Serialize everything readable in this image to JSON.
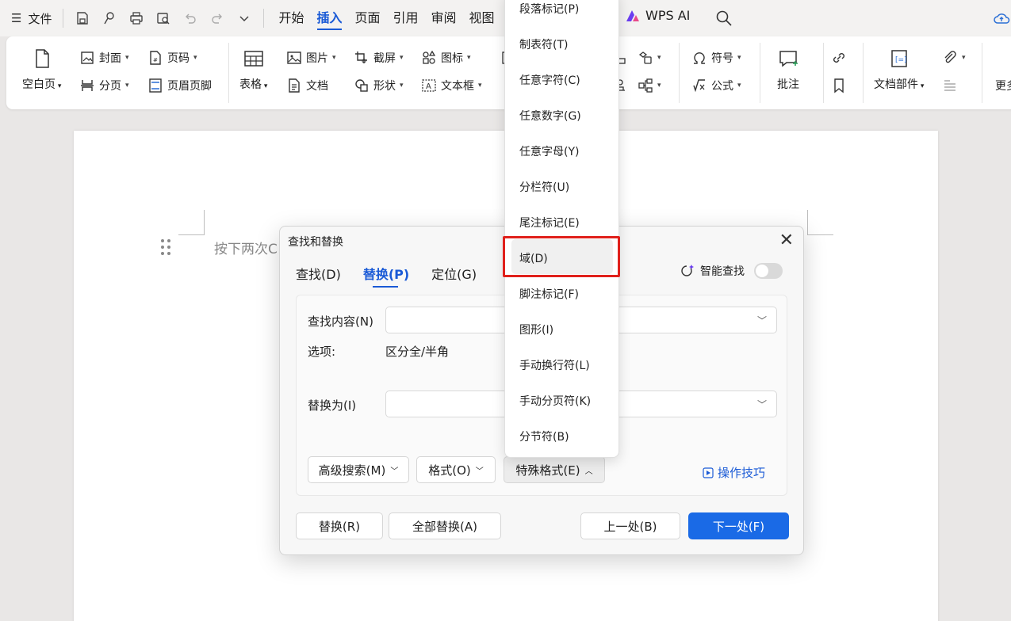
{
  "menubar": {
    "file": "文件",
    "tabs": [
      "开始",
      "插入",
      "页面",
      "引用",
      "审阅",
      "视图"
    ],
    "active_tab": 1,
    "wps_ai": "WPS AI"
  },
  "ribbon": {
    "blank_page": "空白页",
    "cover": "封面",
    "page_break": "分页",
    "page_number": "页码",
    "header_footer": "页眉页脚",
    "table": "表格",
    "picture": "图片",
    "document": "文档",
    "screenshot": "截屏",
    "shape": "形状",
    "icon": "图标",
    "textbox": "文本框",
    "symbol": "符号",
    "formula": "公式",
    "comment": "批注",
    "doc_parts": "文档部件",
    "more": "更多"
  },
  "document": {
    "hint_text": "按下两次C"
  },
  "dialog": {
    "title": "查找和替换",
    "tabs": [
      "查找(D)",
      "替换(P)",
      "定位(G)"
    ],
    "active_tab": 1,
    "smart_search": "智能查找",
    "find_label": "查找内容(N)",
    "options_label": "选项:",
    "options_value": "区分全/半角",
    "replace_label": "替换为(I)",
    "advanced_btn": "高级搜索(M)",
    "format_btn": "格式(O)",
    "special_btn": "特殊格式(E)",
    "tips": "操作技巧",
    "replace_btn": "替换(R)",
    "replace_all_btn": "全部替换(A)",
    "prev_btn": "上一处(B)",
    "next_btn": "下一处(F)"
  },
  "special_menu": {
    "items": [
      "段落标记(P)",
      "制表符(T)",
      "任意字符(C)",
      "任意数字(G)",
      "任意字母(Y)",
      "分栏符(U)",
      "尾注标记(E)",
      "域(D)",
      "脚注标记(F)",
      "图形(I)",
      "手动换行符(L)",
      "手动分页符(K)",
      "分节符(B)"
    ],
    "highlighted_index": 7
  },
  "colors": {
    "accent": "#1a5ad6",
    "primary_button": "#1a6ae6",
    "highlight_box": "#e0201b"
  }
}
